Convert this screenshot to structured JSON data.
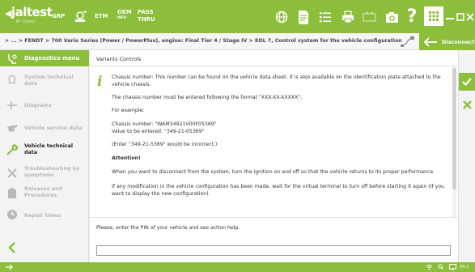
{
  "topbar": {
    "logo_text": "jaltest",
    "logo_sub": "BY COJALI",
    "grp": "GRP",
    "etm": "ETM",
    "oem_line1": "OEM",
    "oem_line2": "INFO",
    "pass_line1": "PASS",
    "pass_line2": "THRU",
    "icons": [
      "car-tools-icon",
      "globe-icon",
      "document-icon",
      "list-icon",
      "printer-icon",
      "battery-icon",
      "camera-icon",
      "help-icon",
      "grid-icon",
      "minimize-icon",
      "maximize-icon",
      "close-icon"
    ]
  },
  "breadcrumb": {
    "text": "> ... > FENDT > 700 Vario Series (Power / PowerPlus), engine: Final Tier 4 / Stage IV > EOL 7, Control system for the vehicle configuration"
  },
  "disconnect": {
    "label": "Disconnect"
  },
  "sidebar": {
    "header": "Diagnostics menu",
    "items": [
      {
        "label": "System technical data",
        "icon": "ohm-icon",
        "active": false
      },
      {
        "label": "Diagrams",
        "icon": "diagram-icon",
        "active": false
      },
      {
        "label": "Vehicle service data",
        "icon": "oil-can-icon",
        "active": false
      },
      {
        "label": "Vehicle technical data",
        "icon": "wrench-icon",
        "active": true
      },
      {
        "label": "Troubleshooting by symptoms",
        "icon": "tools-icon",
        "active": false
      },
      {
        "label": "Releases and Procedures",
        "icon": "clipboard-icon",
        "active": false
      },
      {
        "label": "Repair times",
        "icon": "gear-clock-icon",
        "active": false
      }
    ]
  },
  "main": {
    "title": "Variants Controls",
    "paragraphs": [
      "Chassis number: This number can be found on the vehicle data sheet. It is also available on the identification plate attached to the vehicle chassis.",
      "The chassis number must be entered following the format \"XXX-XX-XXXXX\".",
      "For example:",
      "Chassis number: \"WAM34921V00F05369\"",
      "Value to be entered: \"349-21-05369\"",
      "(Enter \"349-21-5369\" would be incorrect.)",
      "Attention!",
      "When you want to disconnect from the system, turn the ignition on and off so that the vehicle returns to its proper performance.",
      "If any modification in the vehicle configuration has been made, wait for the virtual terminal to turn off before starting it again (if you want to display the new configuration)."
    ],
    "pin_prompt": "Please, enter the PIN of your vehicle and see action help.",
    "pin_value": ""
  },
  "statusbar": {
    "time": "09:2"
  },
  "colors": {
    "accent": "#8cbe3c",
    "text": "#333333"
  }
}
